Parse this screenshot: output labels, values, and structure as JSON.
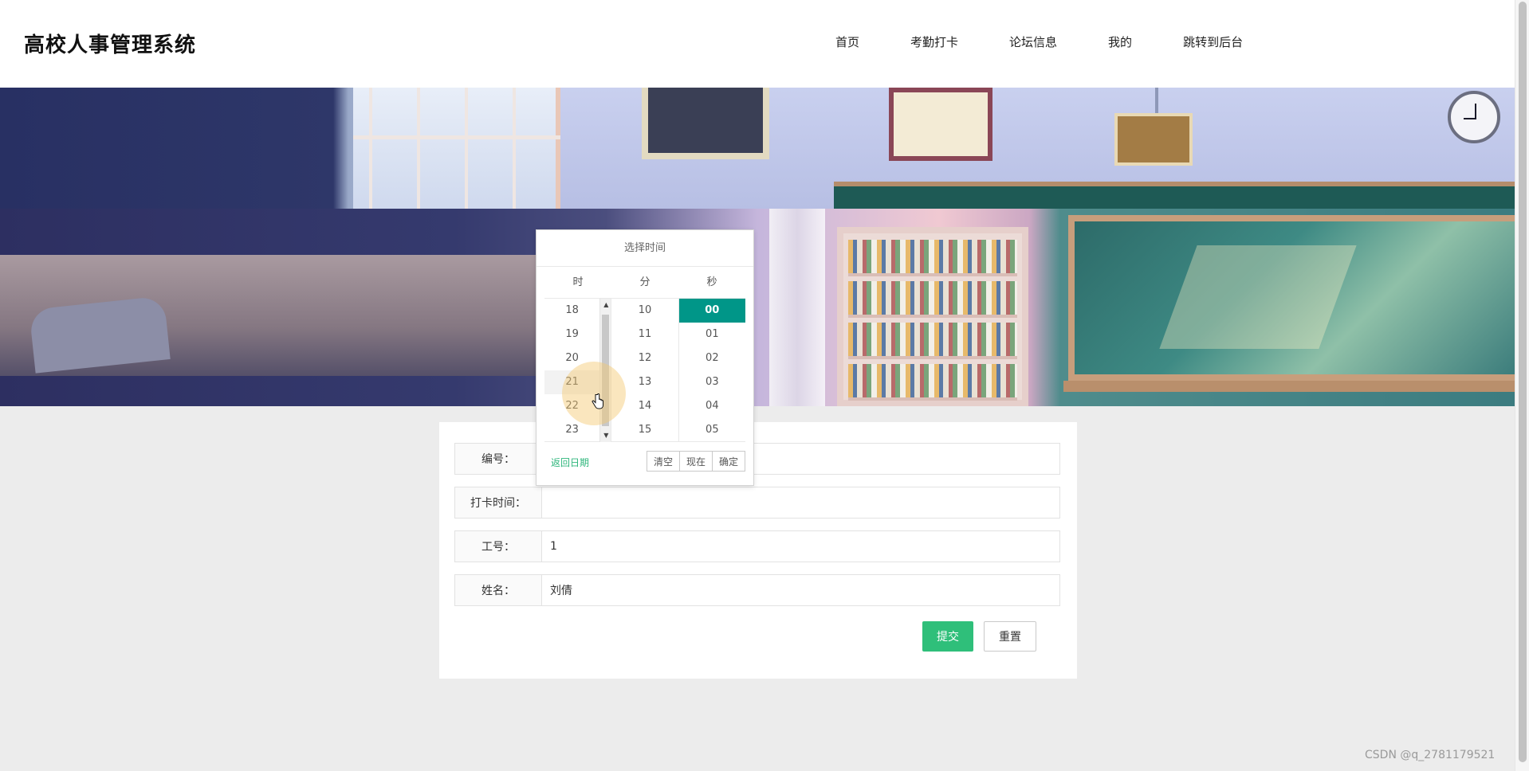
{
  "header": {
    "brand": "高校人事管理系统",
    "nav": [
      "首页",
      "考勤打卡",
      "论坛信息",
      "我的",
      "跳转到后台"
    ]
  },
  "form": {
    "fields": [
      {
        "label": "编号：",
        "value": ""
      },
      {
        "label": "打卡时间：",
        "value": ""
      },
      {
        "label": "工号：",
        "value": "1"
      },
      {
        "label": "姓名：",
        "value": "刘倩"
      }
    ],
    "submit_label": "提交",
    "reset_label": "重置"
  },
  "time_picker": {
    "title": "选择时间",
    "col_headers": [
      "时",
      "分",
      "秒"
    ],
    "hours": [
      "18",
      "19",
      "20",
      "21",
      "22",
      "23"
    ],
    "minutes": [
      "10",
      "11",
      "12",
      "13",
      "14",
      "15"
    ],
    "seconds": [
      "00",
      "01",
      "02",
      "03",
      "04",
      "05"
    ],
    "selected_second": "00",
    "back_label": "返回日期",
    "clear_label": "清空",
    "now_label": "现在",
    "ok_label": "确定"
  },
  "colors": {
    "accent_green": "#2fbf7a",
    "picker_selected": "#009688"
  },
  "watermark": "CSDN @q_2781179521"
}
